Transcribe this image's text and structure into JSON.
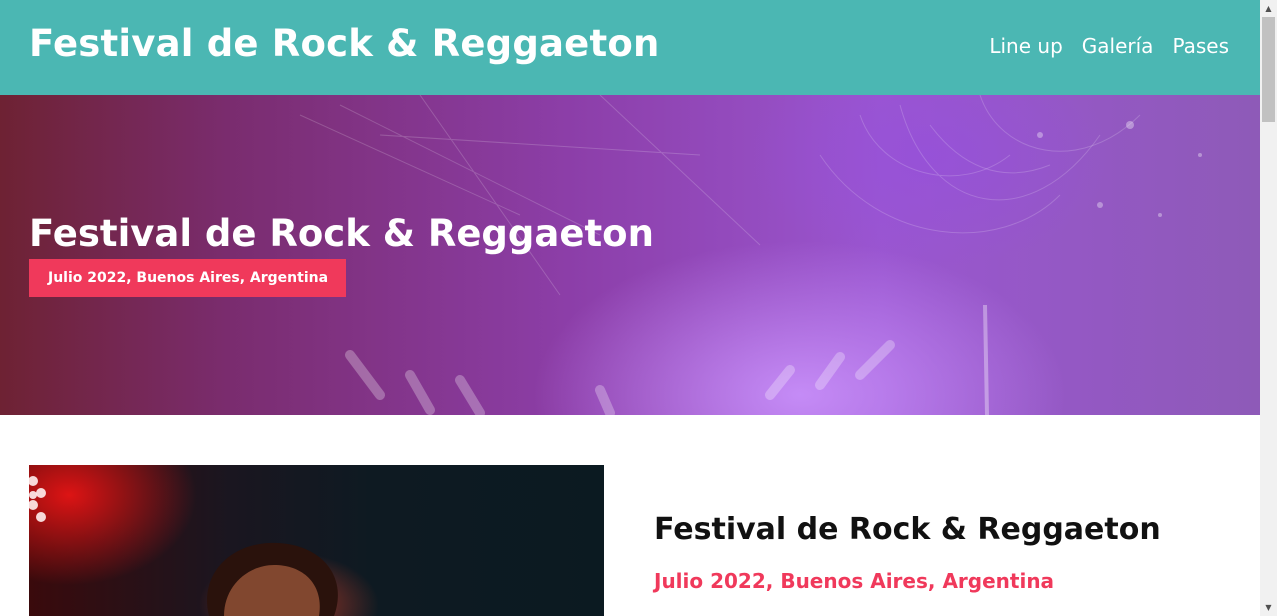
{
  "header": {
    "site_title": "Festival de Rock & Reggaeton",
    "nav": [
      {
        "label": "Line up"
      },
      {
        "label": "Galería"
      },
      {
        "label": "Pases"
      }
    ]
  },
  "hero": {
    "title": "Festival de Rock & Reggaeton",
    "badge": "Julio 2022, Buenos Aires, Argentina"
  },
  "info": {
    "title": "Festival de Rock & Reggaeton",
    "subtitle": "Julio 2022, Buenos Aires, Argentina"
  },
  "colors": {
    "header_bg": "#4bb7b3",
    "accent": "#f0395b",
    "hero_purple": "#9a56d0",
    "text_dark": "#111111"
  },
  "icons": {
    "scroll_up": "▲",
    "scroll_down": "▼"
  }
}
